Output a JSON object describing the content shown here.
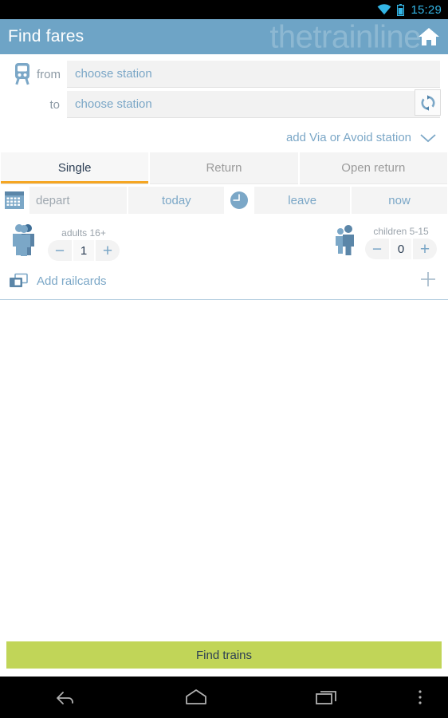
{
  "status_bar": {
    "time": "15:29",
    "wifi_icon": "wifi-icon",
    "battery_icon": "battery-icon",
    "accent_color": "#33b5e5"
  },
  "app_bar": {
    "title": "Find fares",
    "watermark": "thetrainline",
    "home_icon": "home-icon",
    "background_color": "#6ea4c6"
  },
  "journey": {
    "train_icon": "train-icon",
    "from_label": "from",
    "from_value": "choose station",
    "to_label": "to",
    "to_value": "choose station",
    "swap_icon": "swap-stations-icon",
    "via_avoid_label": "add Via or Avoid station",
    "via_avoid_chevron": "chevron-down-icon"
  },
  "ticket_tabs": {
    "items": [
      {
        "label": "Single",
        "active": true
      },
      {
        "label": "Return",
        "active": false
      },
      {
        "label": "Open return",
        "active": false
      }
    ],
    "active_underline_color": "#f5a623"
  },
  "datetime": {
    "calendar_icon": "calendar-icon",
    "depart_label": "depart",
    "depart_value": "today",
    "clock_icon": "clock-icon",
    "leave_label": "leave",
    "leave_value": "now"
  },
  "passengers": {
    "adults": {
      "icon": "adults-icon",
      "caption": "adults 16+",
      "decrement": "−",
      "value": "1",
      "increment": "+"
    },
    "children": {
      "icon": "children-icon",
      "caption": "children 5-15",
      "decrement": "−",
      "value": "0",
      "increment": "+"
    }
  },
  "railcards": {
    "icon": "railcards-icon",
    "label": "Add railcards",
    "add_icon": "plus-icon"
  },
  "cta": {
    "label": "Find trains",
    "background_color": "#c1d558"
  },
  "nav_bar": {
    "back_icon": "back-icon",
    "home_icon": "home-icon",
    "recents_icon": "recents-icon",
    "overflow_icon": "overflow-menu-icon"
  }
}
